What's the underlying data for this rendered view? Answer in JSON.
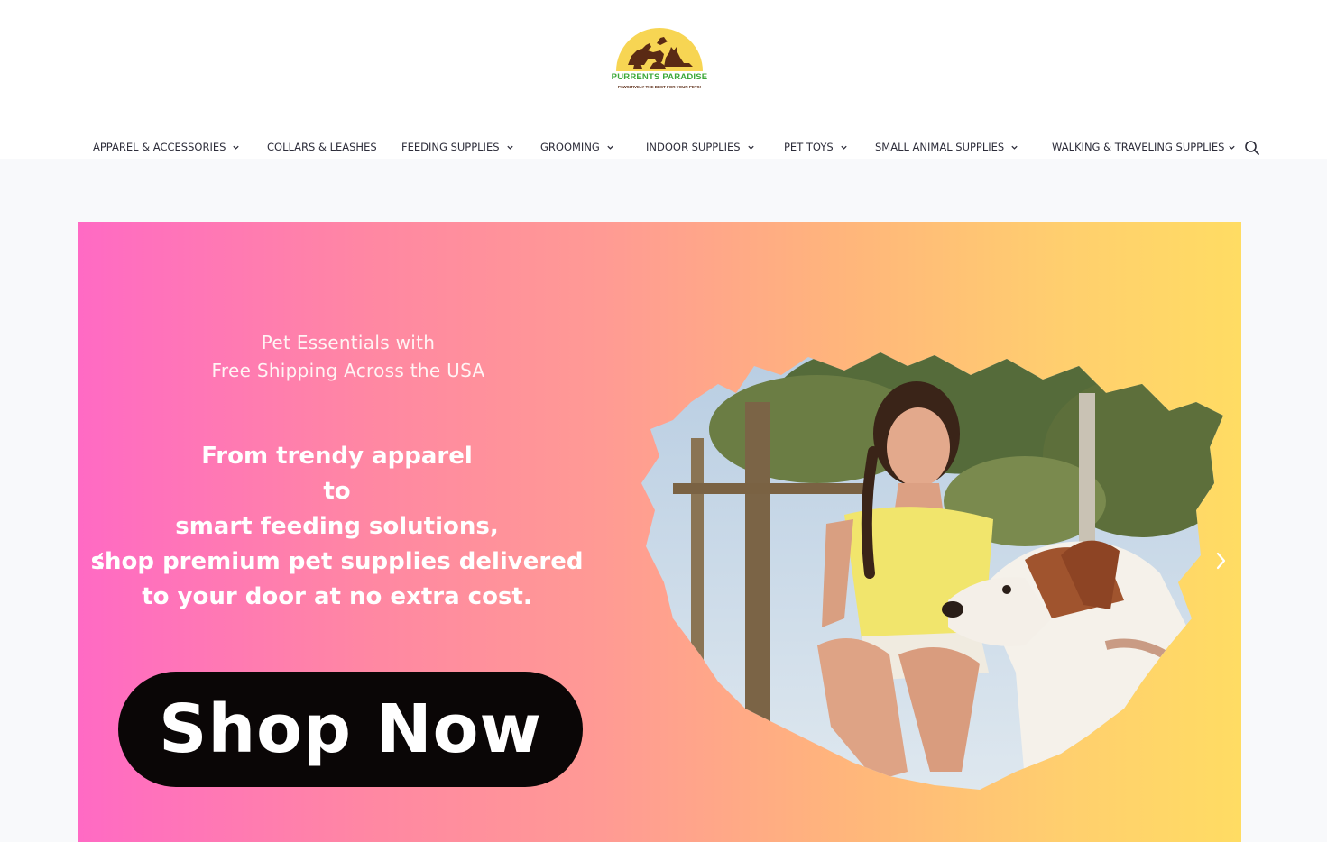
{
  "brand": {
    "name": "PURRENTS PARADISE",
    "tagline": "PAWSITIVELY THE BEST FOR YOUR PETS!",
    "colors": {
      "sun": "#f7d553",
      "name_green": "#3da83a",
      "silhouette": "#5a2a14"
    }
  },
  "nav": {
    "items": [
      {
        "label": "APPAREL & ACCESSORIES",
        "has_dropdown": true
      },
      {
        "label": "COLLARS & LEASHES",
        "has_dropdown": false
      },
      {
        "label": "FEEDING SUPPLIES",
        "has_dropdown": true
      },
      {
        "label": "GROOMING",
        "has_dropdown": true
      },
      {
        "label": "INDOOR SUPPLIES",
        "has_dropdown": true
      },
      {
        "label": "PET TOYS",
        "has_dropdown": true
      },
      {
        "label": "SMALL ANIMAL SUPPLIES",
        "has_dropdown": true
      },
      {
        "label": "WALKING & TRAVELING SUPPLIES",
        "has_dropdown": true
      }
    ],
    "search_icon": "search-icon"
  },
  "hero": {
    "subhead_line1": "Pet Essentials with",
    "subhead_line2": "Free Shipping Across the USA",
    "headline_line1": "From trendy apparel",
    "headline_line2": "to",
    "headline_line3": "smart feeding solutions,",
    "headline_line4": "shop premium pet supplies delivered",
    "headline_line5": "to your door at no extra cost.",
    "cta_label": "Shop Now",
    "prev_icon": "chevron-left-icon",
    "next_icon": "chevron-right-icon",
    "gradient": [
      "#ff6ac4",
      "#ff9a94",
      "#ffdc63"
    ],
    "cta_color": "#0a0606"
  }
}
